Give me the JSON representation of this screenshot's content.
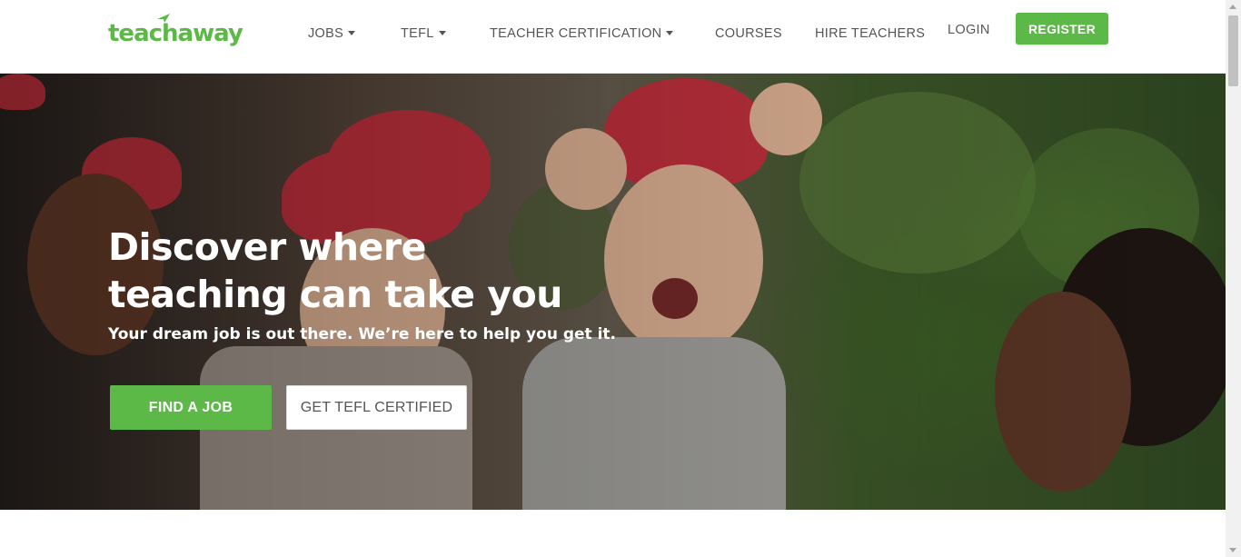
{
  "brand": {
    "logo_text": "teachaway",
    "accent_color": "#5cb947"
  },
  "nav": {
    "items": [
      {
        "label": "JOBS",
        "dropdown": true
      },
      {
        "label": "TEFL",
        "dropdown": true
      },
      {
        "label": "TEACHER CERTIFICATION",
        "dropdown": true
      },
      {
        "label": "COURSES",
        "dropdown": false
      },
      {
        "label": "HIRE TEACHERS",
        "dropdown": false
      }
    ],
    "login_label": "LOGIN",
    "register_label": "REGISTER"
  },
  "hero": {
    "title_line1": "Discover where",
    "title_line2": "teaching can take you",
    "subtitle": "Your dream job is out there. We’re here to help you get it.",
    "primary_cta": "FIND A JOB",
    "secondary_cta": "GET TEFL CERTIFIED"
  }
}
